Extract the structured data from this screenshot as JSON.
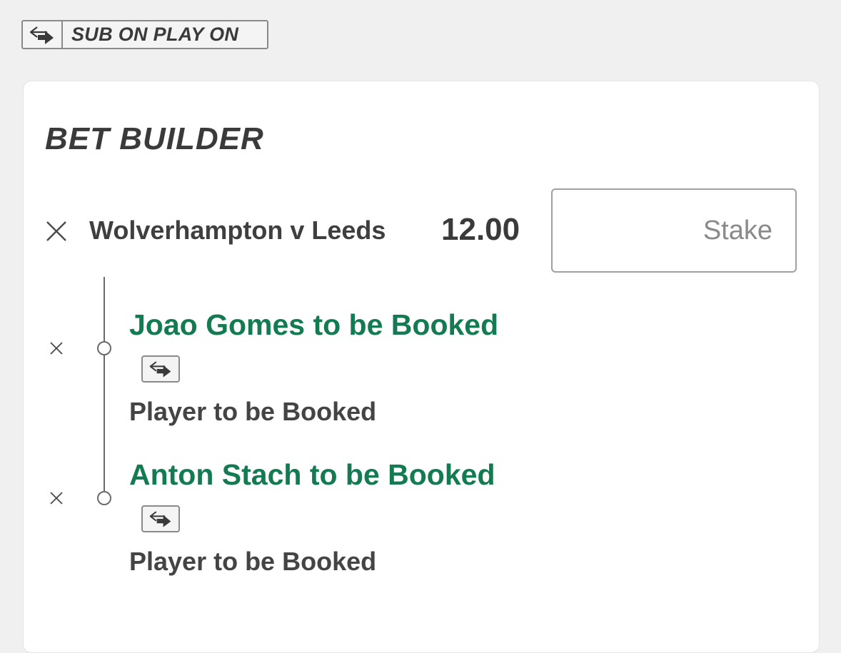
{
  "badge": {
    "label": "SUB ON PLAY ON",
    "icon": "sub-swap-icon"
  },
  "bet_builder": {
    "title": "BET BUILDER",
    "event": {
      "name": "Wolverhampton v Leeds",
      "odds": "12.00",
      "stake_placeholder": "Stake",
      "stake_value": ""
    },
    "selections": [
      {
        "title": "Joao Gomes to be Booked",
        "market": "Player to be Booked",
        "icon": "sub-swap-icon"
      },
      {
        "title": "Anton Stach to be Booked",
        "market": "Player to be Booked",
        "icon": "sub-swap-icon"
      }
    ]
  },
  "colors": {
    "selection_green": "#137a52",
    "text_dark": "#3a3a3a",
    "background": "#f0f0f0"
  }
}
